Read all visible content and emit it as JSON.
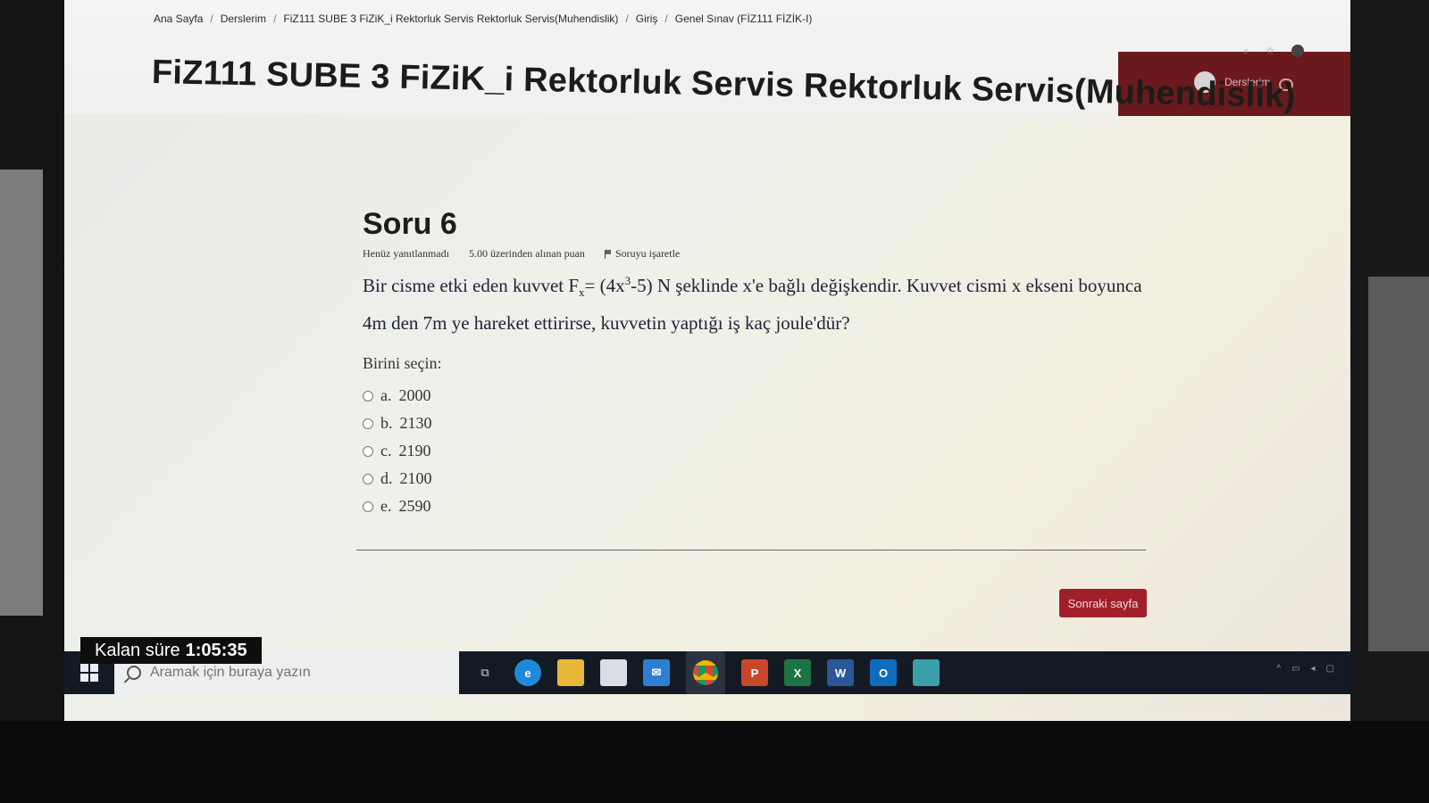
{
  "breadcrumb": {
    "items": [
      "Ana Sayfa",
      "Derslerim",
      "FiZ111 SUBE 3 FiZiK_i Rektorluk Servis Rektorluk Servis(Muhendislik)",
      "Giriş",
      "Genel Sınav (FİZ111 FİZİK-I)"
    ],
    "separator": "/"
  },
  "header": {
    "user_label": "Derslerim"
  },
  "page_title": "FiZ111 SUBE 3 FiZiK_i Rektorluk Servis Rektorluk Servis(Muhendislik)",
  "question": {
    "title": "Soru 6",
    "status": "Henüz yanıtlanmadı",
    "points": "5.00 üzerinden alınan puan",
    "flag_label": "Soruyu işaretle",
    "text_part1": "Bir cisme etki eden kuvvet F",
    "text_sub": "x",
    "text_part2": "= (4x",
    "text_sup": "3",
    "text_part3": "-5) N şeklinde x'e bağlı değişkendir. Kuvvet cismi x ekseni boyunca 4m den 7m ye hareket ettirirse, kuvvetin yaptığı iş kaç joule'dür?",
    "choose_label": "Birini seçin:",
    "options": [
      {
        "letter": "a.",
        "value": "2000"
      },
      {
        "letter": "b.",
        "value": "2130"
      },
      {
        "letter": "c.",
        "value": "2190"
      },
      {
        "letter": "d.",
        "value": "2100"
      },
      {
        "letter": "e.",
        "value": "2590"
      }
    ]
  },
  "next_button": "Sonraki sayfa",
  "timer": {
    "label": "Kalan süre",
    "value": "1:05:35"
  },
  "taskbar": {
    "search_placeholder": "Aramak için buraya yazın",
    "icons": [
      "task-view-icon",
      "edge-icon",
      "file-explorer-icon",
      "store-icon",
      "mail-icon",
      "chrome-icon",
      "powerpoint-icon",
      "excel-icon",
      "word-icon",
      "outlook-icon",
      "app-icon"
    ]
  }
}
